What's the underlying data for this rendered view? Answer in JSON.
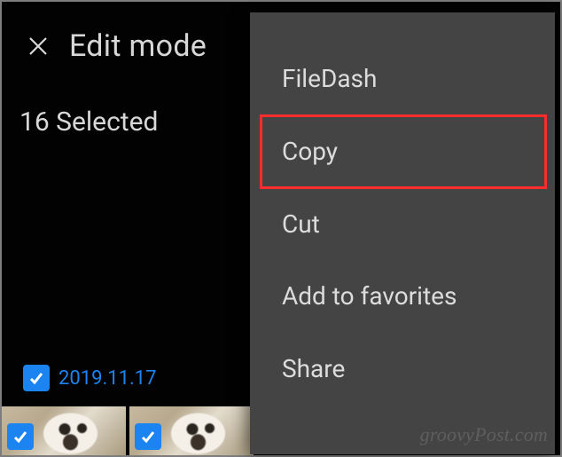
{
  "header": {
    "title": "Edit mode"
  },
  "selection": {
    "text": "16 Selected"
  },
  "date": {
    "label": "2019.11.17"
  },
  "menu": {
    "items": [
      {
        "label": "FileDash"
      },
      {
        "label": "Copy"
      },
      {
        "label": "Cut"
      },
      {
        "label": "Add to favorites"
      },
      {
        "label": "Share"
      }
    ],
    "highlight_index": 1
  },
  "watermark": "groovyPost.com",
  "colors": {
    "accent": "#1b84f1",
    "highlight": "#fb2c2c",
    "menu_bg": "#444444"
  }
}
